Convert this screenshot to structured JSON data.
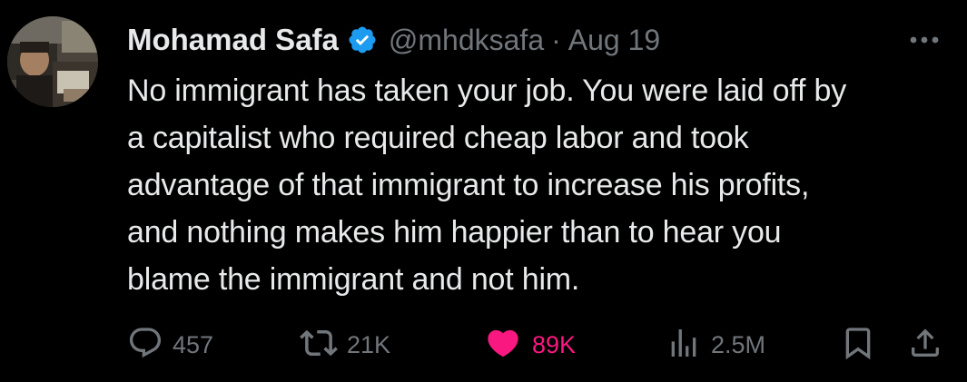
{
  "author": {
    "display_name": "Mohamad Safa",
    "handle": "@mhdksafa",
    "separator": "·",
    "date": "Aug 19",
    "verified_color": "#1d9bf0"
  },
  "tweet": {
    "lines": [
      "No immigrant has taken your job. You were laid off by",
      "a capitalist who required cheap labor and took",
      "advantage of that immigrant to increase his profits,",
      "and nothing makes him happier than to hear you",
      "blame the immigrant and not him."
    ]
  },
  "actions": {
    "replies": "457",
    "retweets": "21K",
    "likes": "89K",
    "views": "2.5M"
  },
  "icons": {
    "avatar": "profile-photo",
    "verified": "verified-badge-icon",
    "more": "more-options-icon",
    "reply": "reply-icon",
    "retweet": "retweet-icon",
    "like": "heart-icon",
    "views": "views-icon",
    "bookmark": "bookmark-icon",
    "share": "share-icon"
  },
  "colors": {
    "background": "#000000",
    "text": "#e7e9ea",
    "muted": "#71767b",
    "like": "#f91880",
    "verified": "#1d9bf0"
  }
}
